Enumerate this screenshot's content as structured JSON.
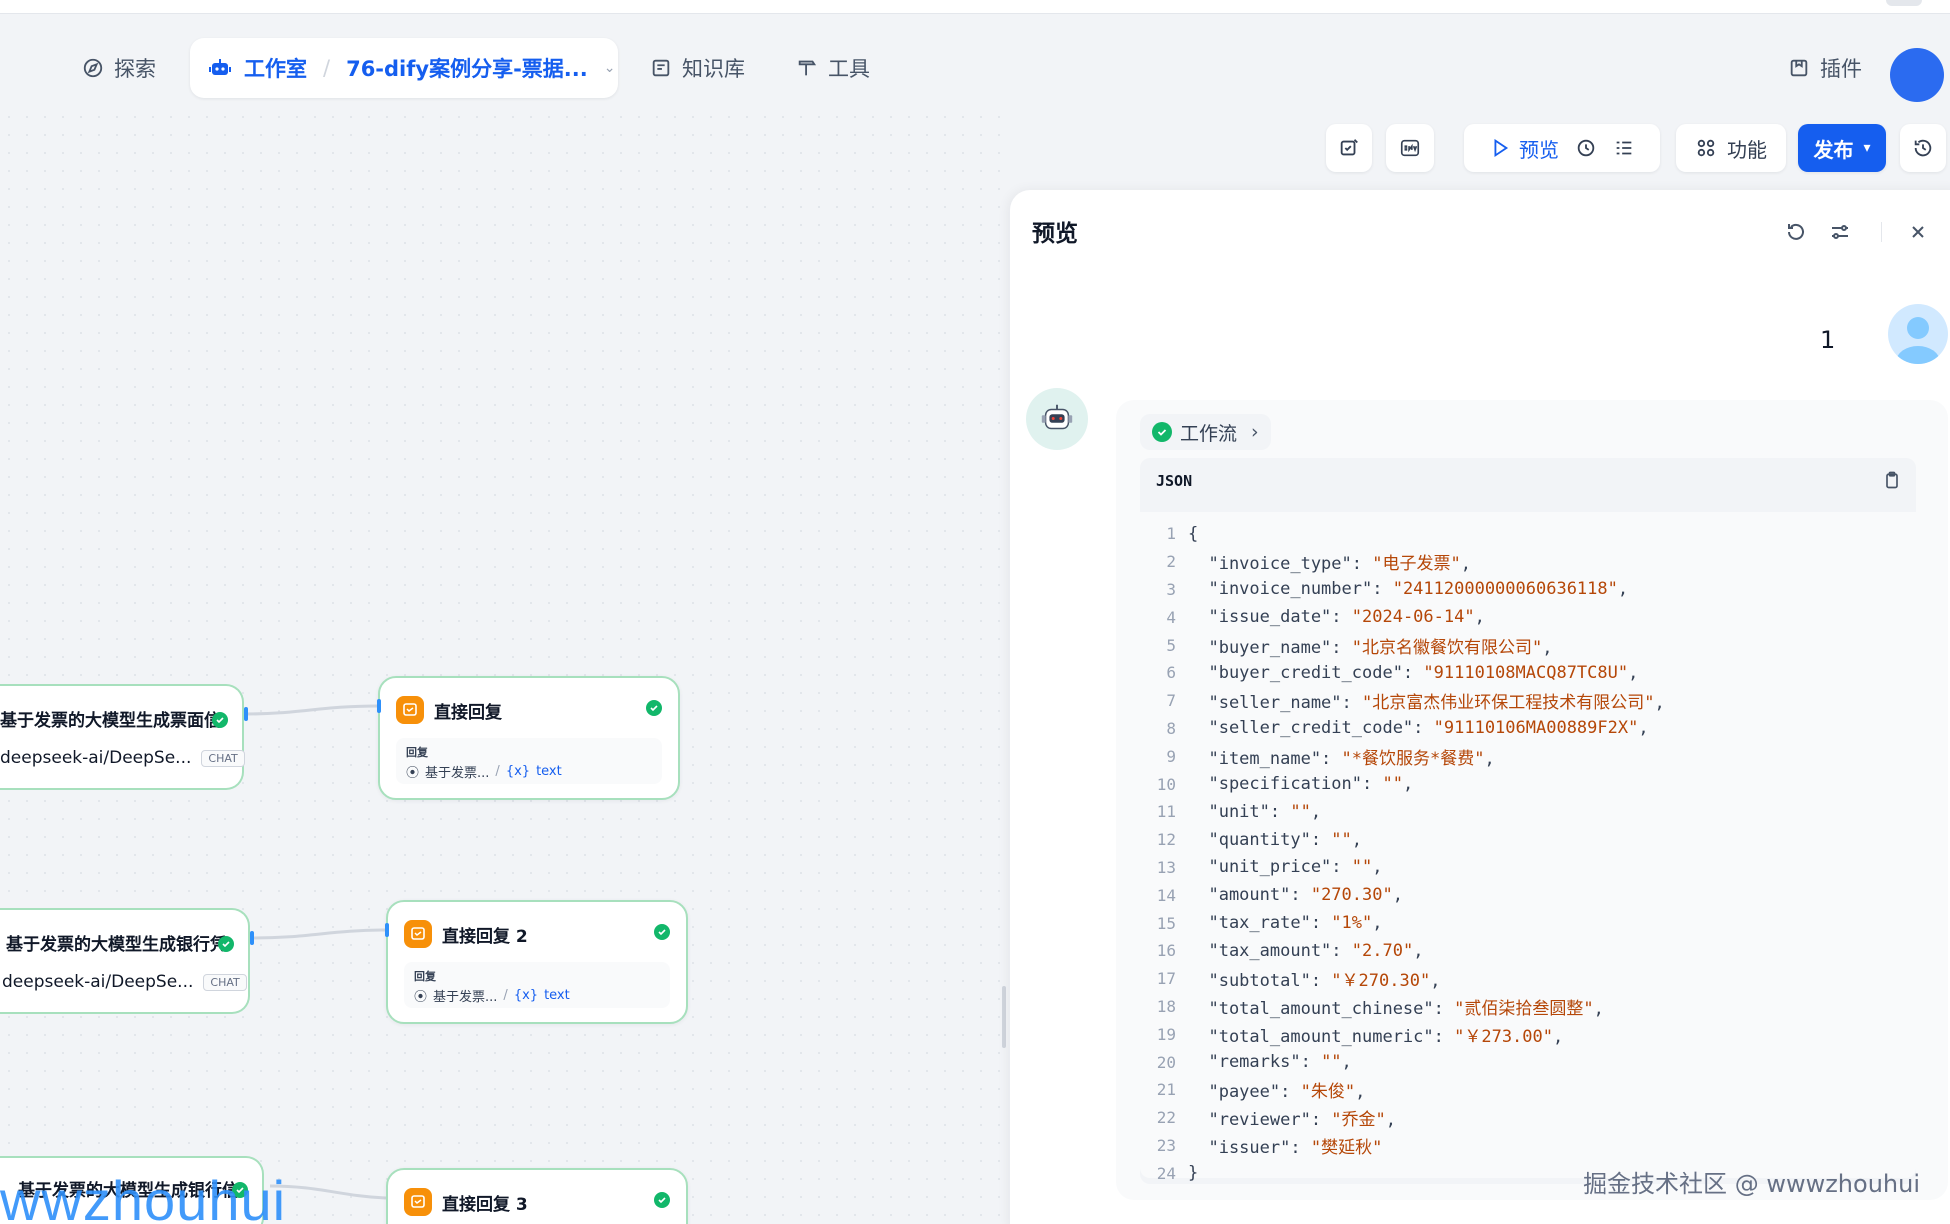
{
  "nav": {
    "explore": "探索",
    "studio": "工作室",
    "app_name": "76-dify案例分享-票据...",
    "knowledge": "知识库",
    "tools": "工具",
    "plugins": "插件"
  },
  "toolbar": {
    "preview": "预览",
    "features": "功能",
    "publish": "发布"
  },
  "nodes": [
    {
      "title": "直接回复",
      "label": "回复",
      "source": "基于发票...",
      "var": "text"
    },
    {
      "title": "直接回复 2",
      "label": "回复",
      "source": "基于发票...",
      "var": "text"
    },
    {
      "title": "直接回复 3"
    }
  ],
  "llm_nodes": [
    {
      "title": "基于发票的大模型生成票面信",
      "model": "deepseek-ai/DeepSe...",
      "tag": "CHAT"
    },
    {
      "title": "基于发票的大模型生成银行凭",
      "model": "deepseek-ai/DeepSe...",
      "tag": "CHAT"
    },
    {
      "title": "基于发票的大模型生成银行信"
    }
  ],
  "panel": {
    "title": "预览",
    "user_message": "1",
    "workflow_label": "工作流",
    "code_lang": "JSON",
    "code_lines": [
      "{",
      "  \"invoice_type\": \"电子发票\",",
      "  \"invoice_number\": \"24112000000060636118\",",
      "  \"issue_date\": \"2024-06-14\",",
      "  \"buyer_name\": \"北京名徽餐饮有限公司\",",
      "  \"buyer_credit_code\": \"91110108MACQ87TC8U\",",
      "  \"seller_name\": \"北京富杰伟业环保工程技术有限公司\",",
      "  \"seller_credit_code\": \"91110106MA00889F2X\",",
      "  \"item_name\": \"*餐饮服务*餐费\",",
      "  \"specification\": \"\",",
      "  \"unit\": \"\",",
      "  \"quantity\": \"\",",
      "  \"unit_price\": \"\",",
      "  \"amount\": \"270.30\",",
      "  \"tax_rate\": \"1%\",",
      "  \"tax_amount\": \"2.70\",",
      "  \"subtotal\": \"￥270.30\",",
      "  \"total_amount_chinese\": \"贰佰柒拾叁圆整\",",
      "  \"total_amount_numeric\": \"￥273.00\",",
      "  \"remarks\": \"\",",
      "  \"payee\": \"朱俊\",",
      "  \"reviewer\": \"乔金\",",
      "  \"issuer\": \"樊延秋\"",
      "}"
    ]
  },
  "watermarks": {
    "left": "wwzhouhui",
    "right": "掘金技术社区 @ wwwzhouhui"
  }
}
